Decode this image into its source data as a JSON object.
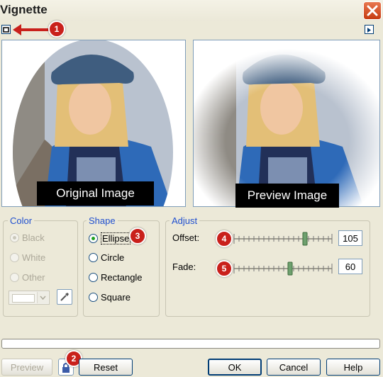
{
  "window": {
    "title": "Vignette"
  },
  "panes": {
    "original_caption": "Original Image",
    "preview_caption": "Preview Image"
  },
  "color_group": {
    "legend": "Color",
    "options": [
      "Black",
      "White",
      "Other"
    ],
    "selected": "Black",
    "enabled": false
  },
  "shape_group": {
    "legend": "Shape",
    "options": [
      "Ellipse",
      "Circle",
      "Rectangle",
      "Square"
    ],
    "selected": "Ellipse"
  },
  "adjust_group": {
    "legend": "Adjust",
    "offset_label": "Offset:",
    "offset_value": "105",
    "fade_label": "Fade:",
    "fade_value": "60"
  },
  "buttons": {
    "preview": "Preview",
    "reset": "Reset",
    "ok": "OK",
    "cancel": "Cancel",
    "help": "Help"
  },
  "callouts": [
    "1",
    "2",
    "3",
    "4",
    "5"
  ],
  "colors": {
    "callout_red": "#c9201b",
    "group_legend_blue": "#1f4fcf"
  }
}
